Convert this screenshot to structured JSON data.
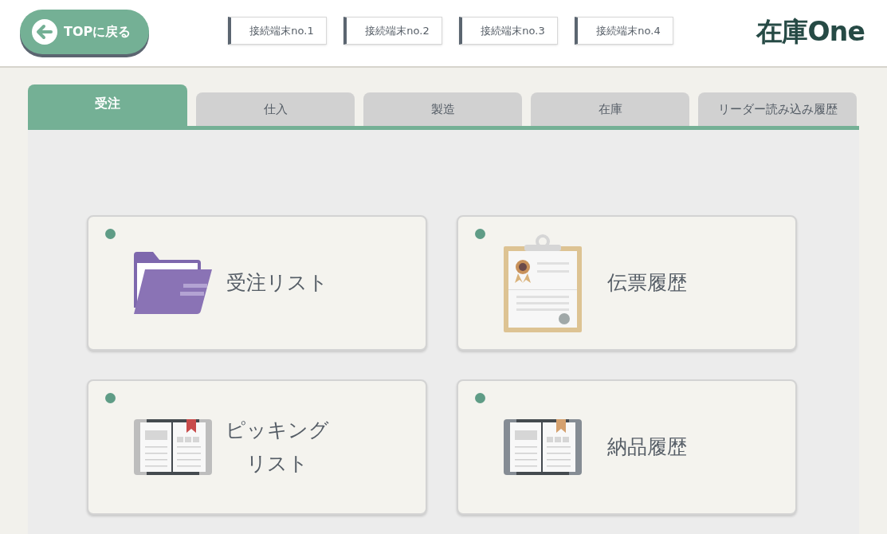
{
  "header": {
    "back_button": "TOPに戻る",
    "terminals": [
      "接続端末no.1",
      "接続端末no.2",
      "接続端末no.3",
      "接続端末no.4"
    ],
    "logo": "在庫One"
  },
  "tabs": [
    {
      "label": "受注",
      "selected": true
    },
    {
      "label": "仕入",
      "selected": false
    },
    {
      "label": "製造",
      "selected": false
    },
    {
      "label": "在庫",
      "selected": false
    },
    {
      "label": "リーダー読み込み履歴",
      "selected": false
    }
  ],
  "cards": [
    {
      "label": "受注リスト",
      "kind": "folder"
    },
    {
      "label": "伝票履歴",
      "kind": "clipboard"
    },
    {
      "label": "ピッキングリスト",
      "kind": "book-red"
    },
    {
      "label": "納品履歴",
      "kind": "book-tan"
    }
  ]
}
